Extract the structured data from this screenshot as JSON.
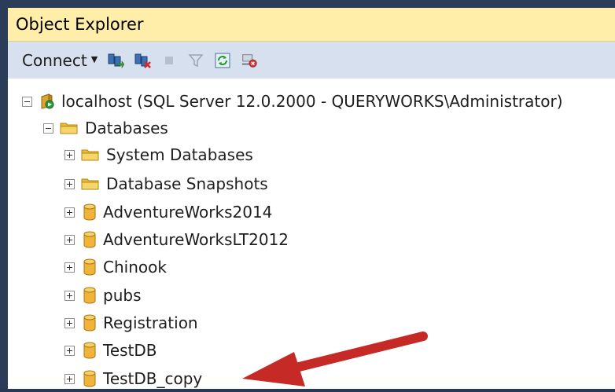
{
  "panel": {
    "title": "Object Explorer"
  },
  "toolbar": {
    "connect_label": "Connect",
    "buttons": [
      "connect-object-explorer-icon",
      "disconnect-icon",
      "stop-icon",
      "filter-icon",
      "refresh-icon",
      "activity-monitor-icon"
    ]
  },
  "tree": {
    "server": {
      "label": "localhost (SQL Server 12.0.2000 - QUERYWORKS\\Administrator)"
    },
    "databases": {
      "label": "Databases"
    },
    "items": [
      {
        "label": "System Databases",
        "type": "folder"
      },
      {
        "label": "Database Snapshots",
        "type": "folder"
      },
      {
        "label": "AdventureWorks2014",
        "type": "database"
      },
      {
        "label": "AdventureWorksLT2012",
        "type": "database"
      },
      {
        "label": "Chinook",
        "type": "database"
      },
      {
        "label": "pubs",
        "type": "database"
      },
      {
        "label": "Registration",
        "type": "database"
      },
      {
        "label": "TestDB",
        "type": "database"
      },
      {
        "label": "TestDB_copy",
        "type": "database"
      }
    ]
  },
  "colors": {
    "title_bg": "#ffeeaa",
    "toolbar_bg": "#d7e0ee",
    "frame": "#293955",
    "arrow": "#c62a27"
  }
}
